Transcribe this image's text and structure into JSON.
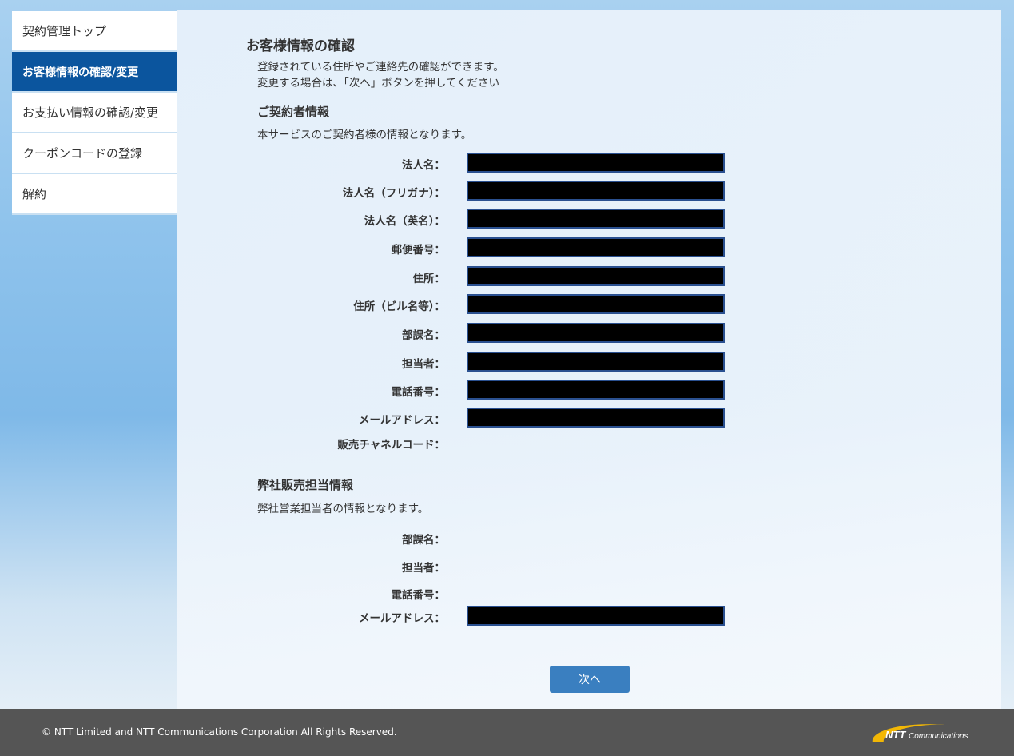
{
  "sidebar": {
    "items": [
      {
        "label": "契約管理トップ"
      },
      {
        "label": "お客様情報の確認/変更",
        "active": true
      },
      {
        "label": "お支払い情報の確認/変更"
      },
      {
        "label": "クーポンコードの登録"
      },
      {
        "label": "解約"
      }
    ]
  },
  "main": {
    "title": "お客様情報の確認",
    "intro_line1": "登録されている住所やご連絡先の確認ができます。",
    "intro_line2": "変更する場合は、「次へ」ボタンを押してください",
    "contractor": {
      "heading": "ご契約者情報",
      "desc": "本サービスのご契約者様の情報となります。",
      "fields": [
        {
          "label": "法人名："
        },
        {
          "label": "法人名（フリガナ）："
        },
        {
          "label": "法人名（英名）："
        },
        {
          "label": "郵便番号："
        },
        {
          "label": "住所："
        },
        {
          "label": "住所（ビル名等）："
        },
        {
          "label": "部課名："
        },
        {
          "label": "担当者："
        },
        {
          "label": "電話番号："
        },
        {
          "label": "メールアドレス："
        },
        {
          "label": "販売チャネルコード："
        }
      ]
    },
    "sales": {
      "heading": "弊社販売担当情報",
      "desc": "弊社営業担当者の情報となります。",
      "fields": [
        {
          "label": "部課名："
        },
        {
          "label": "担当者："
        },
        {
          "label": "電話番号："
        },
        {
          "label": "メールアドレス："
        }
      ]
    },
    "next_button": "次へ"
  },
  "footer": {
    "copyright": "© NTT Limited and NTT Communications Corporation All Rights Reserved.",
    "logo_text": "NTT Communications"
  }
}
